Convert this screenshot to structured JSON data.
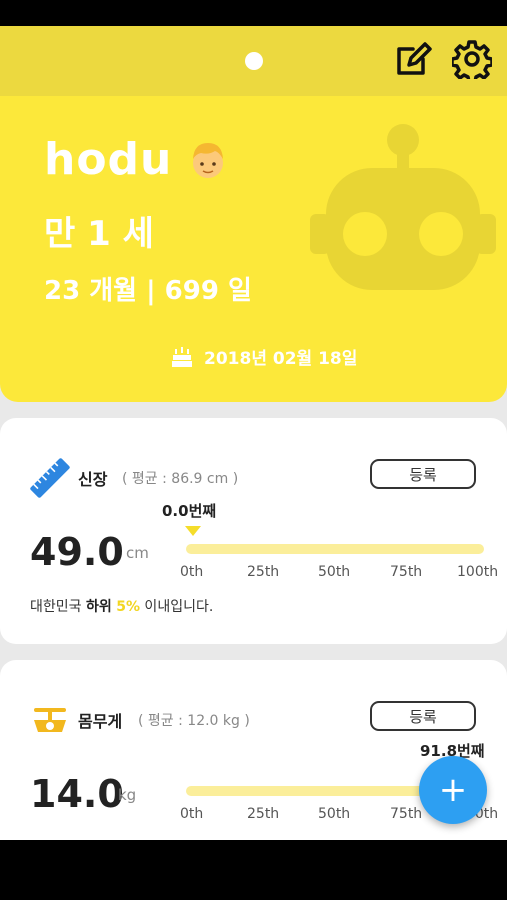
{
  "profile": {
    "name": "hodu",
    "age": "만 1 세",
    "months_days": "23 개월 | 699 일",
    "birthdate": "2018년 02월 18일"
  },
  "height_card": {
    "title": "신장",
    "average": "( 평균 : 86.9 cm )",
    "register_label": "등록",
    "value": "49.0",
    "unit": "cm",
    "rank_label": "0.0번째",
    "percentile": 0.0,
    "ticks": [
      "0th",
      "25th",
      "50th",
      "75th",
      "100th"
    ],
    "desc_prefix": "대한민국 ",
    "desc_bold": "하위",
    "desc_highlight": "5%",
    "desc_suffix": " 이내입니다."
  },
  "weight_card": {
    "title": "몸무게",
    "average": "( 평균 : 12.0 kg )",
    "register_label": "등록",
    "value": "14.0",
    "unit": "kg",
    "rank_label": "91.8번째",
    "percentile": 91.8,
    "ticks": [
      "0th",
      "25th",
      "50th",
      "75th",
      "100th"
    ]
  },
  "fab_label": "+",
  "icons": {
    "edit": "edit-icon",
    "settings": "gear-icon",
    "robot": "robot-icon",
    "cake": "cake-icon",
    "ruler": "ruler-icon",
    "scale": "scale-icon",
    "avatar": "child-avatar-icon"
  },
  "colors": {
    "primary": "#fce83a",
    "header": "#ecd93f",
    "fab": "#2d9ff2",
    "highlight": "#f2d622",
    "bar": "#fbee9a"
  }
}
